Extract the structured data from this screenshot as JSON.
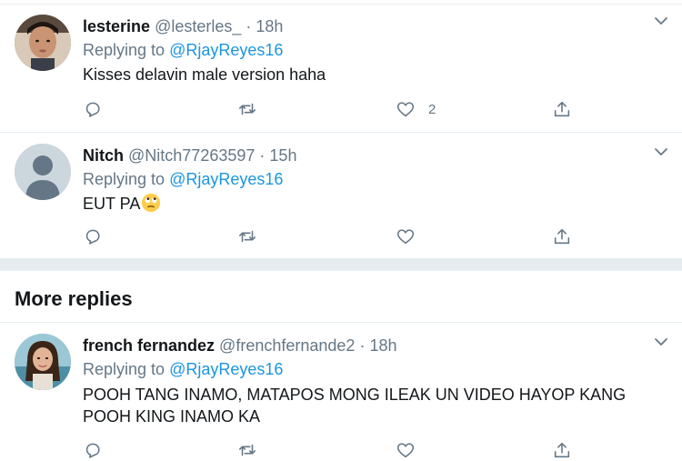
{
  "tweets": [
    {
      "name": "lesterine",
      "handle": "@lesterles_",
      "separator": "·",
      "time": "18h",
      "replying_prefix": "Replying to",
      "replying_to": "@RjayReyes16",
      "text": "Kisses delavin male version haha",
      "like_count": "2"
    },
    {
      "name": "Nitch",
      "handle": "@Nitch77263597",
      "separator": "·",
      "time": "15h",
      "replying_prefix": "Replying to",
      "replying_to": "@RjayReyes16",
      "text": "EUT PA",
      "emoji": "face-with-rolling-eyes"
    },
    {
      "name": "french fernandez",
      "handle": "@frenchfernande2",
      "separator": "·",
      "time": "18h",
      "replying_prefix": "Replying to",
      "replying_to": "@RjayReyes16",
      "text_line1": "POOH TANG INAMO, MATAPOS MONG ILEAK UN VIDEO HAYOP KANG",
      "text_line2": "POOH KING INAMO KA"
    }
  ],
  "section_title": "More replies",
  "colors": {
    "link": "#1b95e0",
    "secondary_text": "#657786",
    "divider": "#e6ecf0",
    "icon": "#657786"
  },
  "icons": [
    "reply-icon",
    "retweet-icon",
    "like-icon",
    "share-icon",
    "chevron-down-icon"
  ]
}
